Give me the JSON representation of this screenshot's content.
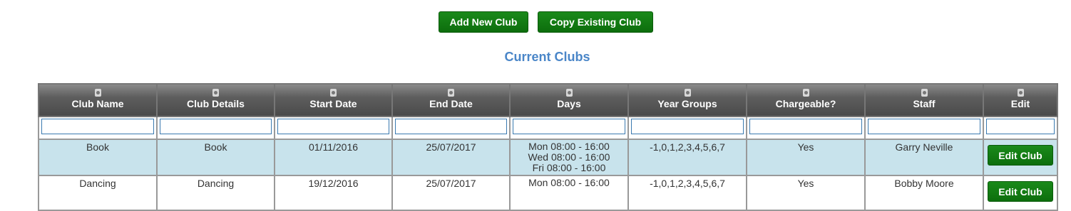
{
  "toolbar": {
    "add_label": "Add New Club",
    "copy_label": "Copy Existing Club"
  },
  "heading": "Current Clubs",
  "table": {
    "columns": [
      "Club Name",
      "Club Details",
      "Start Date",
      "End Date",
      "Days",
      "Year Groups",
      "Chargeable?",
      "Staff",
      "Edit"
    ],
    "rows": [
      {
        "club_name": "Book",
        "club_details": "Book",
        "start_date": "01/11/2016",
        "end_date": "25/07/2017",
        "days": [
          "Mon 08:00 - 16:00",
          "Wed 08:00 - 16:00",
          "Fri 08:00 - 16:00"
        ],
        "year_groups": "-1,0,1,2,3,4,5,6,7",
        "chargeable": "Yes",
        "staff": "Garry Neville",
        "edit_label": "Edit Club"
      },
      {
        "club_name": "Dancing",
        "club_details": "Dancing",
        "start_date": "19/12/2016",
        "end_date": "25/07/2017",
        "days": [
          "Mon 08:00 - 16:00"
        ],
        "year_groups": "-1,0,1,2,3,4,5,6,7",
        "chargeable": "Yes",
        "staff": "Bobby Moore",
        "edit_label": "Edit Club"
      }
    ]
  },
  "colors": {
    "button_green": "#117c11",
    "heading_blue": "#4a86c8",
    "row_highlight": "#c8e3ec"
  }
}
